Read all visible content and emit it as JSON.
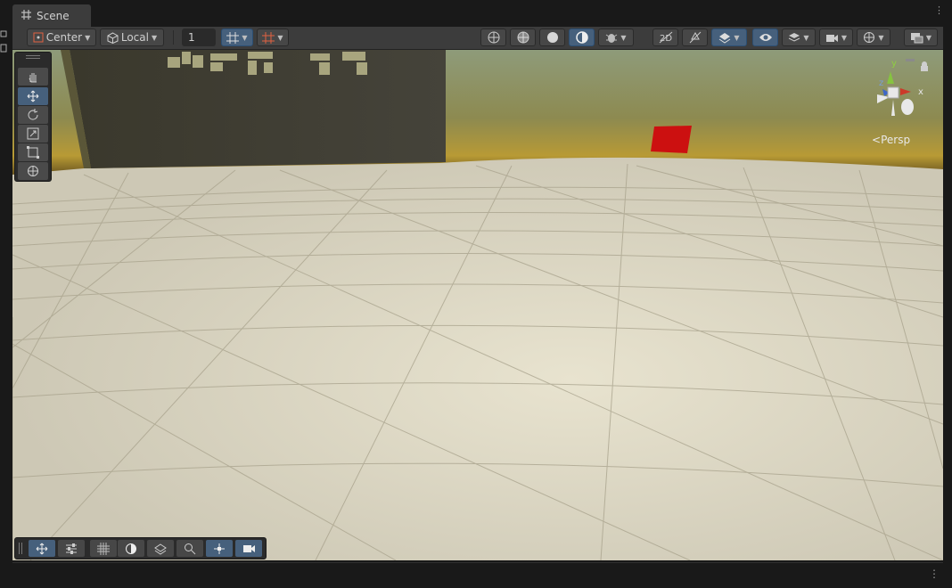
{
  "window": {
    "tab_title": "Scene",
    "tab_icon": "grid-icon",
    "menu_icon": "kebab-menu-icon"
  },
  "toolbar": {
    "pivot_label": "Center",
    "pivot_icon": "pivot-center-icon",
    "space_label": "Local",
    "space_icon": "local-cube-icon",
    "grid_snap_value": "1",
    "draw_modes": [
      "wireframe-sphere-icon",
      "shaded-wireframe-icon",
      "shaded-sphere-icon",
      "lighting-mode-icon",
      "debug-bug-icon"
    ],
    "right_icons": [
      "2d-toggle-icon",
      "lighting-toggle-icon",
      "effects-icon",
      "visibility-eye-icon",
      "layers-icon",
      "camera-icon",
      "gizmos-icon",
      "render-mode-icon"
    ]
  },
  "tools": [
    "hand-icon",
    "move-icon",
    "rotate-icon",
    "scale-icon",
    "rect-icon",
    "transform-icon"
  ],
  "overlays_bottom": [
    "move-tool-icon",
    "settings-sliders-icon",
    "grid-icon",
    "lighting-icon",
    "effects-icon",
    "search-icon",
    "transform-gizmo-icon",
    "camera-preview-icon"
  ],
  "gizmo": {
    "projection_label": "Persp",
    "axis_x": "x",
    "axis_y": "y",
    "axis_z": "z"
  },
  "scene": {
    "wall_text": "MED 3D",
    "object_color": "#cc1010",
    "floor_color": "#d4cfbb",
    "sky_color": "#8a9870",
    "horizon_color": "#c6a43a"
  },
  "colors": {
    "panel": "#3c3c3c",
    "accent": "#46607c",
    "background": "#191919"
  }
}
